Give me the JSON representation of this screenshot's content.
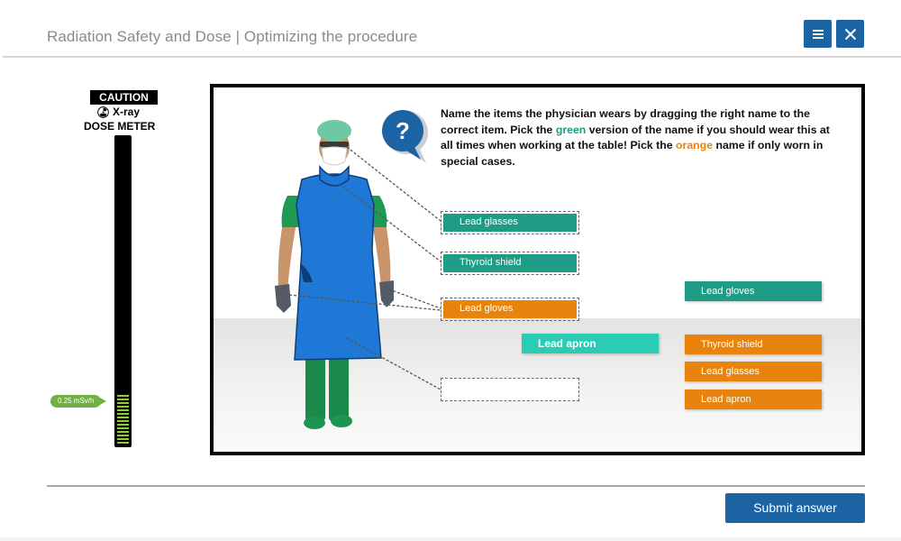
{
  "header": {
    "title": "Radiation Safety and Dose | Optimizing the procedure",
    "menu_icon": "hamburger-menu-icon",
    "close_icon": "close-icon",
    "accent_color": "#1c63a3"
  },
  "dose_meter": {
    "caution_label": "CAUTION",
    "xray_label": "X-ray",
    "title": "DOSE METER",
    "radiation_icon": "radiation-icon",
    "reading": "0.25 mSv/h",
    "level_fraction": 0.16
  },
  "question": {
    "icon": "question-bubble-icon",
    "text_1": "Name the items the physician wears by dragging the right name to the correct item. Pick the ",
    "green_word": "green",
    "text_2": " version of the name if you should wear this at all times when working at the table! Pick the ",
    "orange_word": "orange",
    "text_3": " name if only worn in special cases."
  },
  "slots": [
    {
      "target": "glasses",
      "label": "Lead glasses",
      "color": "green"
    },
    {
      "target": "thyroid",
      "label": "Thyroid shield",
      "color": "green"
    },
    {
      "target": "gloves",
      "label": "Lead gloves",
      "color": "orange"
    },
    {
      "target": "apron",
      "label": "",
      "color": "empty"
    }
  ],
  "dragging_tag": {
    "label": "Lead apron",
    "color": "teal"
  },
  "bank": [
    {
      "label": "Lead gloves",
      "color": "green"
    },
    {
      "label": "Thyroid shield",
      "color": "orange"
    },
    {
      "label": "Lead glasses",
      "color": "orange"
    },
    {
      "label": "Lead apron",
      "color": "orange"
    }
  ],
  "colors": {
    "green": "#1e9c85",
    "orange": "#e8840e",
    "teal": "#2acdb4",
    "meter_green": "#72b043"
  },
  "footer": {
    "submit_label": "Submit answer"
  }
}
